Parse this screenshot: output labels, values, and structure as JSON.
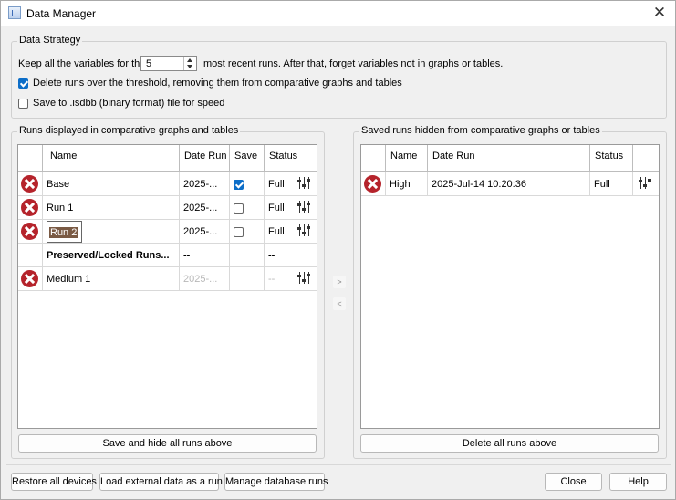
{
  "window": {
    "title": "Data Manager",
    "close_glyph": "✕"
  },
  "strategy": {
    "group_title": "Data Strategy",
    "keep_prefix": "Keep all the variables for the",
    "keep_value": "5",
    "keep_suffix": "most recent runs.  After that, forget variables not in graphs or tables.",
    "delete_label": "Delete runs over the threshold, removing them from comparative graphs and tables",
    "delete_checked": true,
    "save_label": "Save to .isdbb (binary format) file for speed",
    "save_checked": false
  },
  "left_panel": {
    "group_title": "Runs displayed in comparative graphs and tables",
    "columns": [
      "",
      "Name",
      "Date Run",
      "Save",
      "Status",
      ""
    ],
    "rows": [
      {
        "name": "Base",
        "date": "2025-...",
        "save": true,
        "status": "Full",
        "icon": "x-circle-icon",
        "settings": true,
        "style": "normal"
      },
      {
        "name": "Run 1",
        "date": "2025-...",
        "save": false,
        "status": "Full",
        "icon": "x-circle-icon",
        "settings": true,
        "style": "normal"
      },
      {
        "name": "Run 2",
        "date": "2025-...",
        "save": false,
        "status": "Full",
        "icon": "x-circle-icon",
        "settings": true,
        "style": "editing"
      },
      {
        "name": "Preserved/Locked Runs...",
        "date": "--",
        "save": null,
        "status": "--",
        "icon": "",
        "settings": false,
        "style": "bold"
      },
      {
        "name": "Medium 1",
        "date": "2025-...",
        "save": null,
        "status": "--",
        "icon": "x-circle-icon",
        "settings": true,
        "style": "grey"
      }
    ],
    "button": "Save and hide all runs above"
  },
  "move_buttons": {
    "right": ">",
    "left": "<"
  },
  "right_panel": {
    "group_title": "Saved runs hidden from comparative graphs or tables",
    "columns": [
      "",
      "Name",
      "Date Run",
      "Status",
      ""
    ],
    "rows": [
      {
        "name": "High",
        "date": "2025-Jul-14 10:20:36",
        "status": "Full",
        "icon": "x-circle-icon",
        "settings": true
      }
    ],
    "button": "Delete all runs above"
  },
  "footer": {
    "restore": "Restore all devices",
    "load": "Load external data as a run",
    "manage": "Manage database runs",
    "close": "Close",
    "help": "Help"
  },
  "colors": {
    "accent": "#0d6ec8",
    "delete_icon": "#b5232b",
    "edit_highlight": "#7a5a44"
  }
}
